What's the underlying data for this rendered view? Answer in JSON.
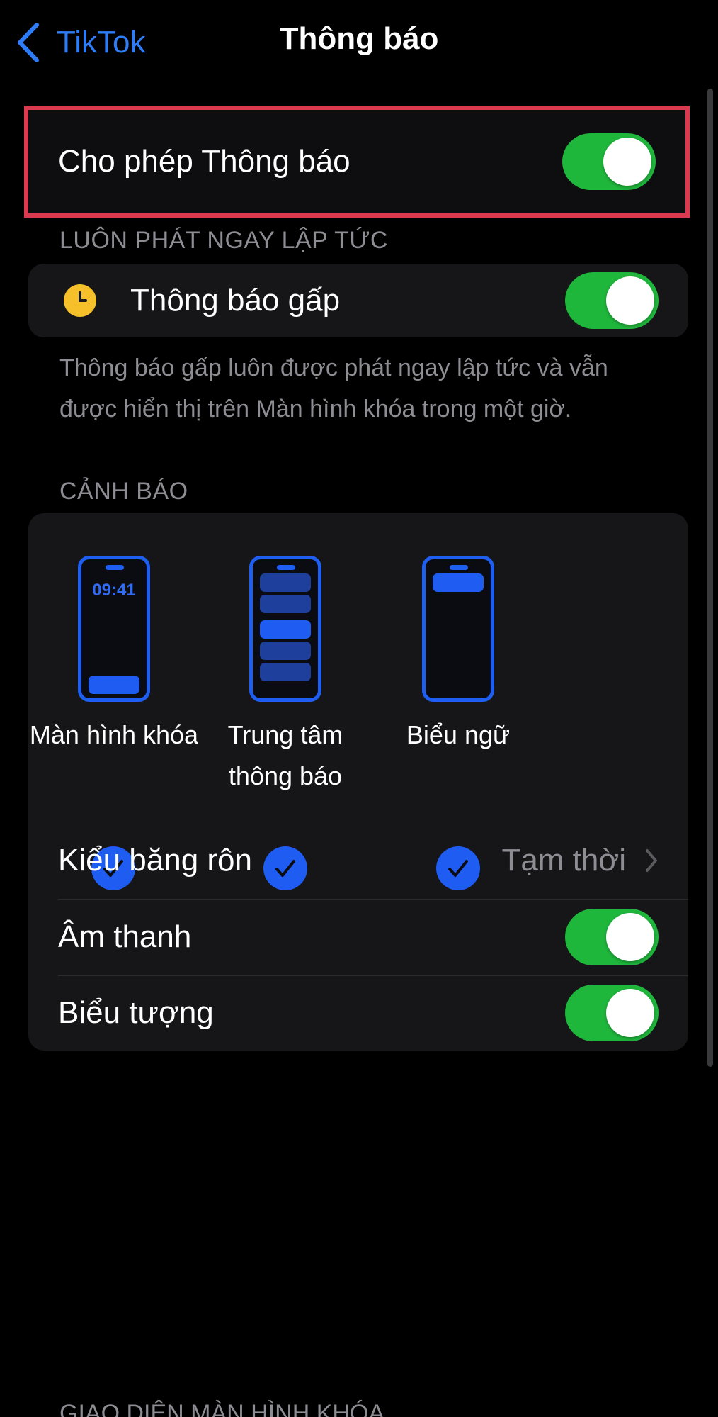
{
  "nav": {
    "back_label": "TikTok",
    "title": "Thông báo"
  },
  "allow": {
    "label": "Cho phép Thông báo",
    "on": true
  },
  "immediate": {
    "header": "LUÔN PHÁT NGAY LẬP TỨC",
    "label": "Thông báo gấp",
    "on": true,
    "footer": "Thông báo gấp luôn được phát ngay lập tức và vẫn được hiển thị trên Màn hình khóa trong một giờ."
  },
  "alerts": {
    "header": "CẢNH BÁO",
    "options": [
      {
        "label": "Màn hình khóa",
        "time": "09:41",
        "checked": true
      },
      {
        "label": "Trung tâm thông báo",
        "checked": true
      },
      {
        "label": "Biểu ngữ",
        "checked": true
      }
    ],
    "banner_style": {
      "label": "Kiểu băng rôn",
      "value": "Tạm thời"
    },
    "sounds": {
      "label": "Âm thanh",
      "on": true
    },
    "badges": {
      "label": "Biểu tượng",
      "on": true
    }
  },
  "next_section_header": "GIAO DIỆN MÀN HÌNH KHÓA",
  "colors": {
    "accent": "#2f7df6",
    "toggle_on": "#1fb63c",
    "check": "#1f5cf2",
    "highlight": "#d93a4f"
  }
}
